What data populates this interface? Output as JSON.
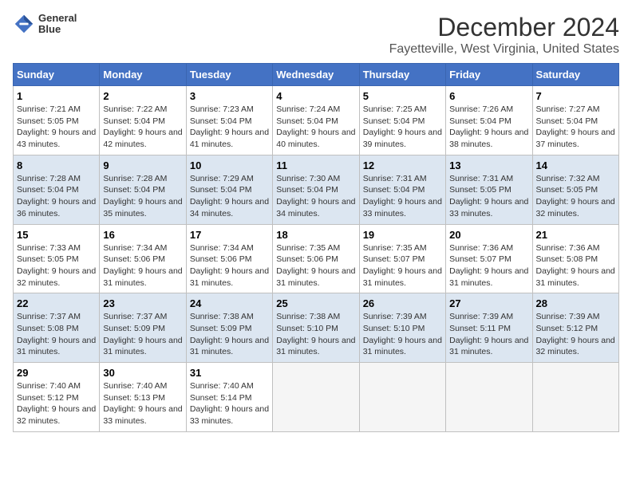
{
  "logo": {
    "line1": "General",
    "line2": "Blue"
  },
  "title": "December 2024",
  "subtitle": "Fayetteville, West Virginia, United States",
  "days_header": [
    "Sunday",
    "Monday",
    "Tuesday",
    "Wednesday",
    "Thursday",
    "Friday",
    "Saturday"
  ],
  "weeks": [
    [
      {
        "day": "1",
        "sunrise": "7:21 AM",
        "sunset": "5:05 PM",
        "daylight": "9 hours and 43 minutes."
      },
      {
        "day": "2",
        "sunrise": "7:22 AM",
        "sunset": "5:04 PM",
        "daylight": "9 hours and 42 minutes."
      },
      {
        "day": "3",
        "sunrise": "7:23 AM",
        "sunset": "5:04 PM",
        "daylight": "9 hours and 41 minutes."
      },
      {
        "day": "4",
        "sunrise": "7:24 AM",
        "sunset": "5:04 PM",
        "daylight": "9 hours and 40 minutes."
      },
      {
        "day": "5",
        "sunrise": "7:25 AM",
        "sunset": "5:04 PM",
        "daylight": "9 hours and 39 minutes."
      },
      {
        "day": "6",
        "sunrise": "7:26 AM",
        "sunset": "5:04 PM",
        "daylight": "9 hours and 38 minutes."
      },
      {
        "day": "7",
        "sunrise": "7:27 AM",
        "sunset": "5:04 PM",
        "daylight": "9 hours and 37 minutes."
      }
    ],
    [
      {
        "day": "8",
        "sunrise": "7:28 AM",
        "sunset": "5:04 PM",
        "daylight": "9 hours and 36 minutes."
      },
      {
        "day": "9",
        "sunrise": "7:28 AM",
        "sunset": "5:04 PM",
        "daylight": "9 hours and 35 minutes."
      },
      {
        "day": "10",
        "sunrise": "7:29 AM",
        "sunset": "5:04 PM",
        "daylight": "9 hours and 34 minutes."
      },
      {
        "day": "11",
        "sunrise": "7:30 AM",
        "sunset": "5:04 PM",
        "daylight": "9 hours and 34 minutes."
      },
      {
        "day": "12",
        "sunrise": "7:31 AM",
        "sunset": "5:04 PM",
        "daylight": "9 hours and 33 minutes."
      },
      {
        "day": "13",
        "sunrise": "7:31 AM",
        "sunset": "5:05 PM",
        "daylight": "9 hours and 33 minutes."
      },
      {
        "day": "14",
        "sunrise": "7:32 AM",
        "sunset": "5:05 PM",
        "daylight": "9 hours and 32 minutes."
      }
    ],
    [
      {
        "day": "15",
        "sunrise": "7:33 AM",
        "sunset": "5:05 PM",
        "daylight": "9 hours and 32 minutes."
      },
      {
        "day": "16",
        "sunrise": "7:34 AM",
        "sunset": "5:06 PM",
        "daylight": "9 hours and 31 minutes."
      },
      {
        "day": "17",
        "sunrise": "7:34 AM",
        "sunset": "5:06 PM",
        "daylight": "9 hours and 31 minutes."
      },
      {
        "day": "18",
        "sunrise": "7:35 AM",
        "sunset": "5:06 PM",
        "daylight": "9 hours and 31 minutes."
      },
      {
        "day": "19",
        "sunrise": "7:35 AM",
        "sunset": "5:07 PM",
        "daylight": "9 hours and 31 minutes."
      },
      {
        "day": "20",
        "sunrise": "7:36 AM",
        "sunset": "5:07 PM",
        "daylight": "9 hours and 31 minutes."
      },
      {
        "day": "21",
        "sunrise": "7:36 AM",
        "sunset": "5:08 PM",
        "daylight": "9 hours and 31 minutes."
      }
    ],
    [
      {
        "day": "22",
        "sunrise": "7:37 AM",
        "sunset": "5:08 PM",
        "daylight": "9 hours and 31 minutes."
      },
      {
        "day": "23",
        "sunrise": "7:37 AM",
        "sunset": "5:09 PM",
        "daylight": "9 hours and 31 minutes."
      },
      {
        "day": "24",
        "sunrise": "7:38 AM",
        "sunset": "5:09 PM",
        "daylight": "9 hours and 31 minutes."
      },
      {
        "day": "25",
        "sunrise": "7:38 AM",
        "sunset": "5:10 PM",
        "daylight": "9 hours and 31 minutes."
      },
      {
        "day": "26",
        "sunrise": "7:39 AM",
        "sunset": "5:10 PM",
        "daylight": "9 hours and 31 minutes."
      },
      {
        "day": "27",
        "sunrise": "7:39 AM",
        "sunset": "5:11 PM",
        "daylight": "9 hours and 31 minutes."
      },
      {
        "day": "28",
        "sunrise": "7:39 AM",
        "sunset": "5:12 PM",
        "daylight": "9 hours and 32 minutes."
      }
    ],
    [
      {
        "day": "29",
        "sunrise": "7:40 AM",
        "sunset": "5:12 PM",
        "daylight": "9 hours and 32 minutes."
      },
      {
        "day": "30",
        "sunrise": "7:40 AM",
        "sunset": "5:13 PM",
        "daylight": "9 hours and 33 minutes."
      },
      {
        "day": "31",
        "sunrise": "7:40 AM",
        "sunset": "5:14 PM",
        "daylight": "9 hours and 33 minutes."
      },
      null,
      null,
      null,
      null
    ]
  ],
  "labels": {
    "sunrise": "Sunrise:",
    "sunset": "Sunset:",
    "daylight": "Daylight:"
  },
  "accent_color": "#4472C4"
}
